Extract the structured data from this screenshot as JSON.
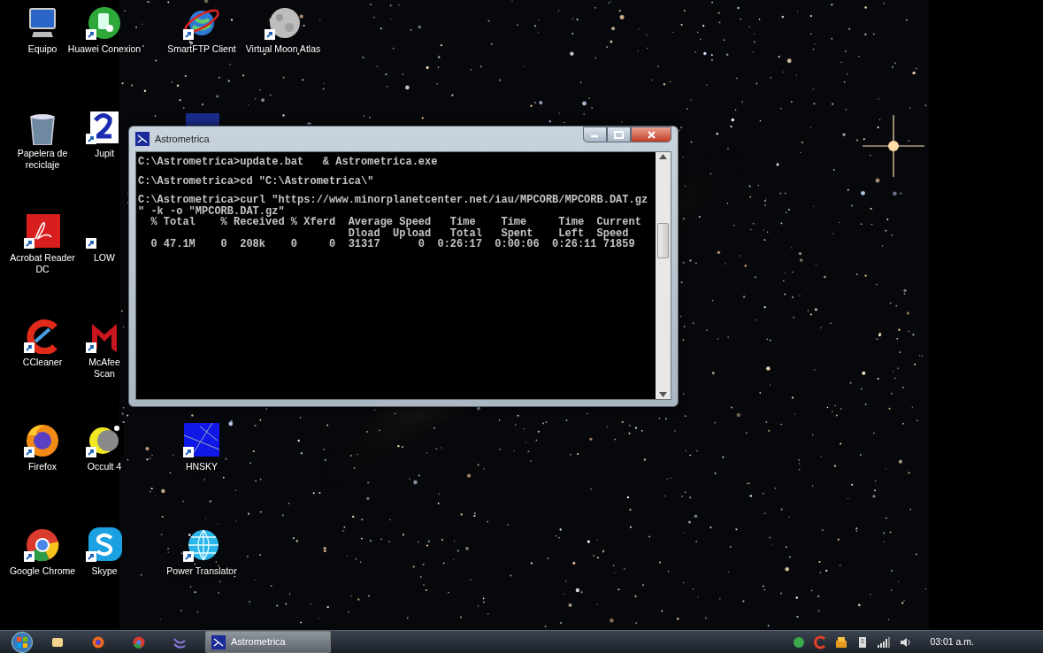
{
  "desktop": {
    "rows": [
      [
        {
          "kind": "computer",
          "label": "Equipo"
        },
        {
          "kind": "green-app",
          "label": "Huawei Conexion"
        },
        {
          "kind": "globe-ring",
          "label": "SmartFTP Client"
        },
        {
          "kind": "moon",
          "label": "Virtual Moon Atlas"
        }
      ],
      [
        {
          "kind": "recycle-bin",
          "label": "Papelera de reciclaje"
        },
        {
          "kind": "jupiter",
          "label": "Jupit"
        },
        {
          "kind": "sky-peek"
        }
      ],
      [
        {
          "kind": "pdf",
          "label": "Acrobat Reader DC"
        },
        {
          "kind": "blank",
          "label": "LOW"
        }
      ],
      [
        {
          "kind": "ccleaner",
          "label": "CCleaner"
        },
        {
          "kind": "mcafee",
          "label": "McAfee Scan"
        }
      ],
      [
        {
          "kind": "firefox",
          "label": "Firefox"
        },
        {
          "kind": "crescent",
          "label": "Occult 4"
        },
        {
          "kind": "sky",
          "label": "HNSKY"
        }
      ],
      [
        {
          "kind": "chrome",
          "label": "Google Chrome"
        },
        {
          "kind": "skype",
          "label": "Skype"
        },
        {
          "kind": "wire-globe",
          "label": "Power Translator"
        }
      ]
    ]
  },
  "console_window": {
    "title": "Astrometrica",
    "blocks": [
      [
        "C:\\Astrometrica>update.bat   & Astrometrica.exe"
      ],
      [
        "C:\\Astrometrica>cd \"C:\\Astrometrica\\\""
      ],
      [
        "C:\\Astrometrica>curl \"https://www.minorplanetcenter.net/iau/MPCORB/MPCORB.DAT.gz",
        "\" -k -o \"MPCORB.DAT.gz\"",
        "  % Total    % Received % Xferd  Average Speed   Time    Time     Time  Current",
        "                                 Dload  Upload   Total   Spent    Left  Speed",
        "  0 47.1M    0  208k    0     0  31317      0  0:26:17  0:00:06  0:26:11 71859"
      ]
    ]
  },
  "taskbar": {
    "pinned": [
      {
        "kind": "folder"
      },
      {
        "kind": "firefox"
      },
      {
        "kind": "chrome"
      },
      {
        "kind": "app"
      }
    ],
    "tasks": [
      {
        "label": "Astrometrica",
        "selected": true
      }
    ],
    "tray": [
      {
        "kind": "green-app"
      },
      {
        "kind": "ccleaner"
      },
      {
        "kind": "network-tool"
      },
      {
        "kind": "device"
      },
      {
        "kind": "signal"
      },
      {
        "kind": "volume"
      }
    ],
    "clock": "03:01 a.m."
  }
}
